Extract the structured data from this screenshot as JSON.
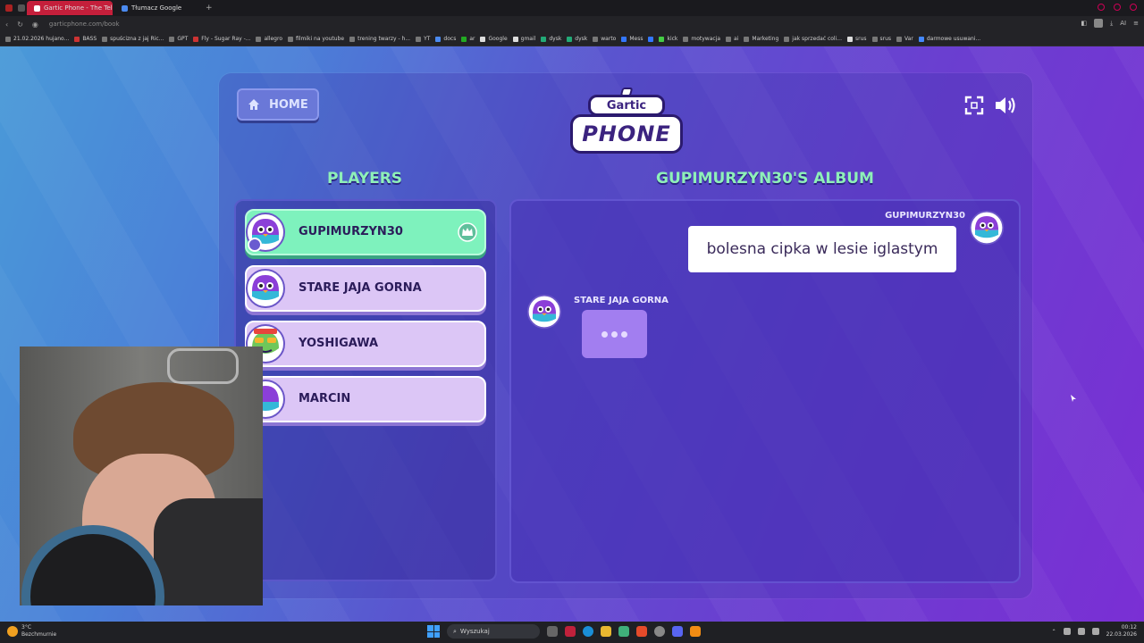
{
  "browser": {
    "tabs": [
      {
        "label": "Gartic Phone - The Telep",
        "active": true
      },
      {
        "label": "Tłumacz Google",
        "active": false
      }
    ],
    "new_tab": "+",
    "url": "garticphone.com/book",
    "bookmarks": [
      "21.02.2026 hujano...",
      "BASS",
      "spuścizna z jaj Ric...",
      "GPT",
      "Fly - Sugar Ray -...",
      "allegro",
      "filmiki na youtube",
      "trening twarzy - h...",
      "YT",
      "docs",
      "ar",
      "Google",
      "gmail",
      "dysk",
      "dysk",
      "warto",
      "Mess",
      "kick",
      "motywacja",
      "ai",
      "Marketing",
      "jak sprzedać coli...",
      "srus",
      "srus",
      "Var",
      "darmowe usuwani..."
    ],
    "profile_label": "AI"
  },
  "game": {
    "home_label": "HOME",
    "logo_top": "Gartic",
    "logo_bottom": "PHONE",
    "players_title": "PLAYERS",
    "album_title": "GUPIMURZYN30'S ALBUM",
    "players": [
      {
        "name": "GUPIMURZYN30",
        "host": true
      },
      {
        "name": "STARE JAJA GORNA",
        "host": false
      },
      {
        "name": "YOSHIGAWA",
        "host": false
      },
      {
        "name": "MARCIN",
        "host": false
      }
    ],
    "album": {
      "entry1": {
        "author": "GUPIMURZYN30",
        "text": "bolesna cipka w lesie iglastym"
      },
      "entry2": {
        "author": "STARE JAJA GORNA",
        "status": "typing"
      }
    },
    "colors": {
      "accent_green": "#8ef0b8",
      "host_card": "#7ef2bd",
      "player_card": "#dcc6f6"
    }
  },
  "taskbar": {
    "weather_temp": "3°C",
    "weather_desc": "Bezchmurnie",
    "search_placeholder": "Wyszukaj",
    "time": "00:12",
    "date": "22.03.2026"
  }
}
